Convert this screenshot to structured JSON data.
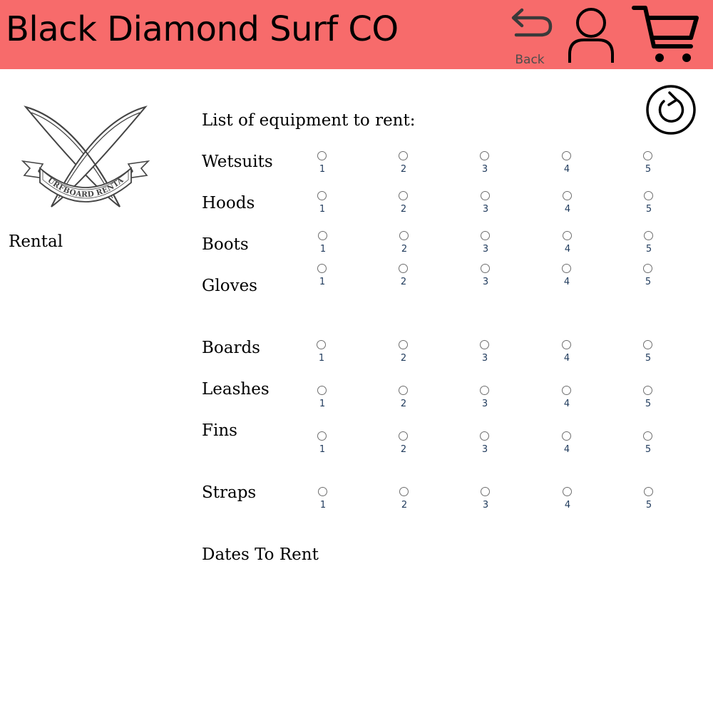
{
  "header": {
    "brand": "Black Diamond Surf CO",
    "back_label": "Back",
    "icons": [
      "back-arrow-icon",
      "user-icon",
      "cart-icon"
    ],
    "background_color": "#f76b6b"
  },
  "logo": {
    "text": "SURFBOARD RENTAL"
  },
  "sidebar": {
    "caption": "Rental"
  },
  "form": {
    "heading": "List of equipment to rent:",
    "options": [
      "1",
      "2",
      "3",
      "4",
      "5"
    ],
    "rows": [
      {
        "label": "Wetsuits"
      },
      {
        "label": "Hoods"
      },
      {
        "label": "Boots"
      },
      {
        "label": "Gloves"
      },
      {
        "label": "Boards"
      },
      {
        "label": "Leashes"
      },
      {
        "label": "Fins"
      },
      {
        "label": "Straps"
      }
    ],
    "dates_heading": "Dates To Rent"
  }
}
